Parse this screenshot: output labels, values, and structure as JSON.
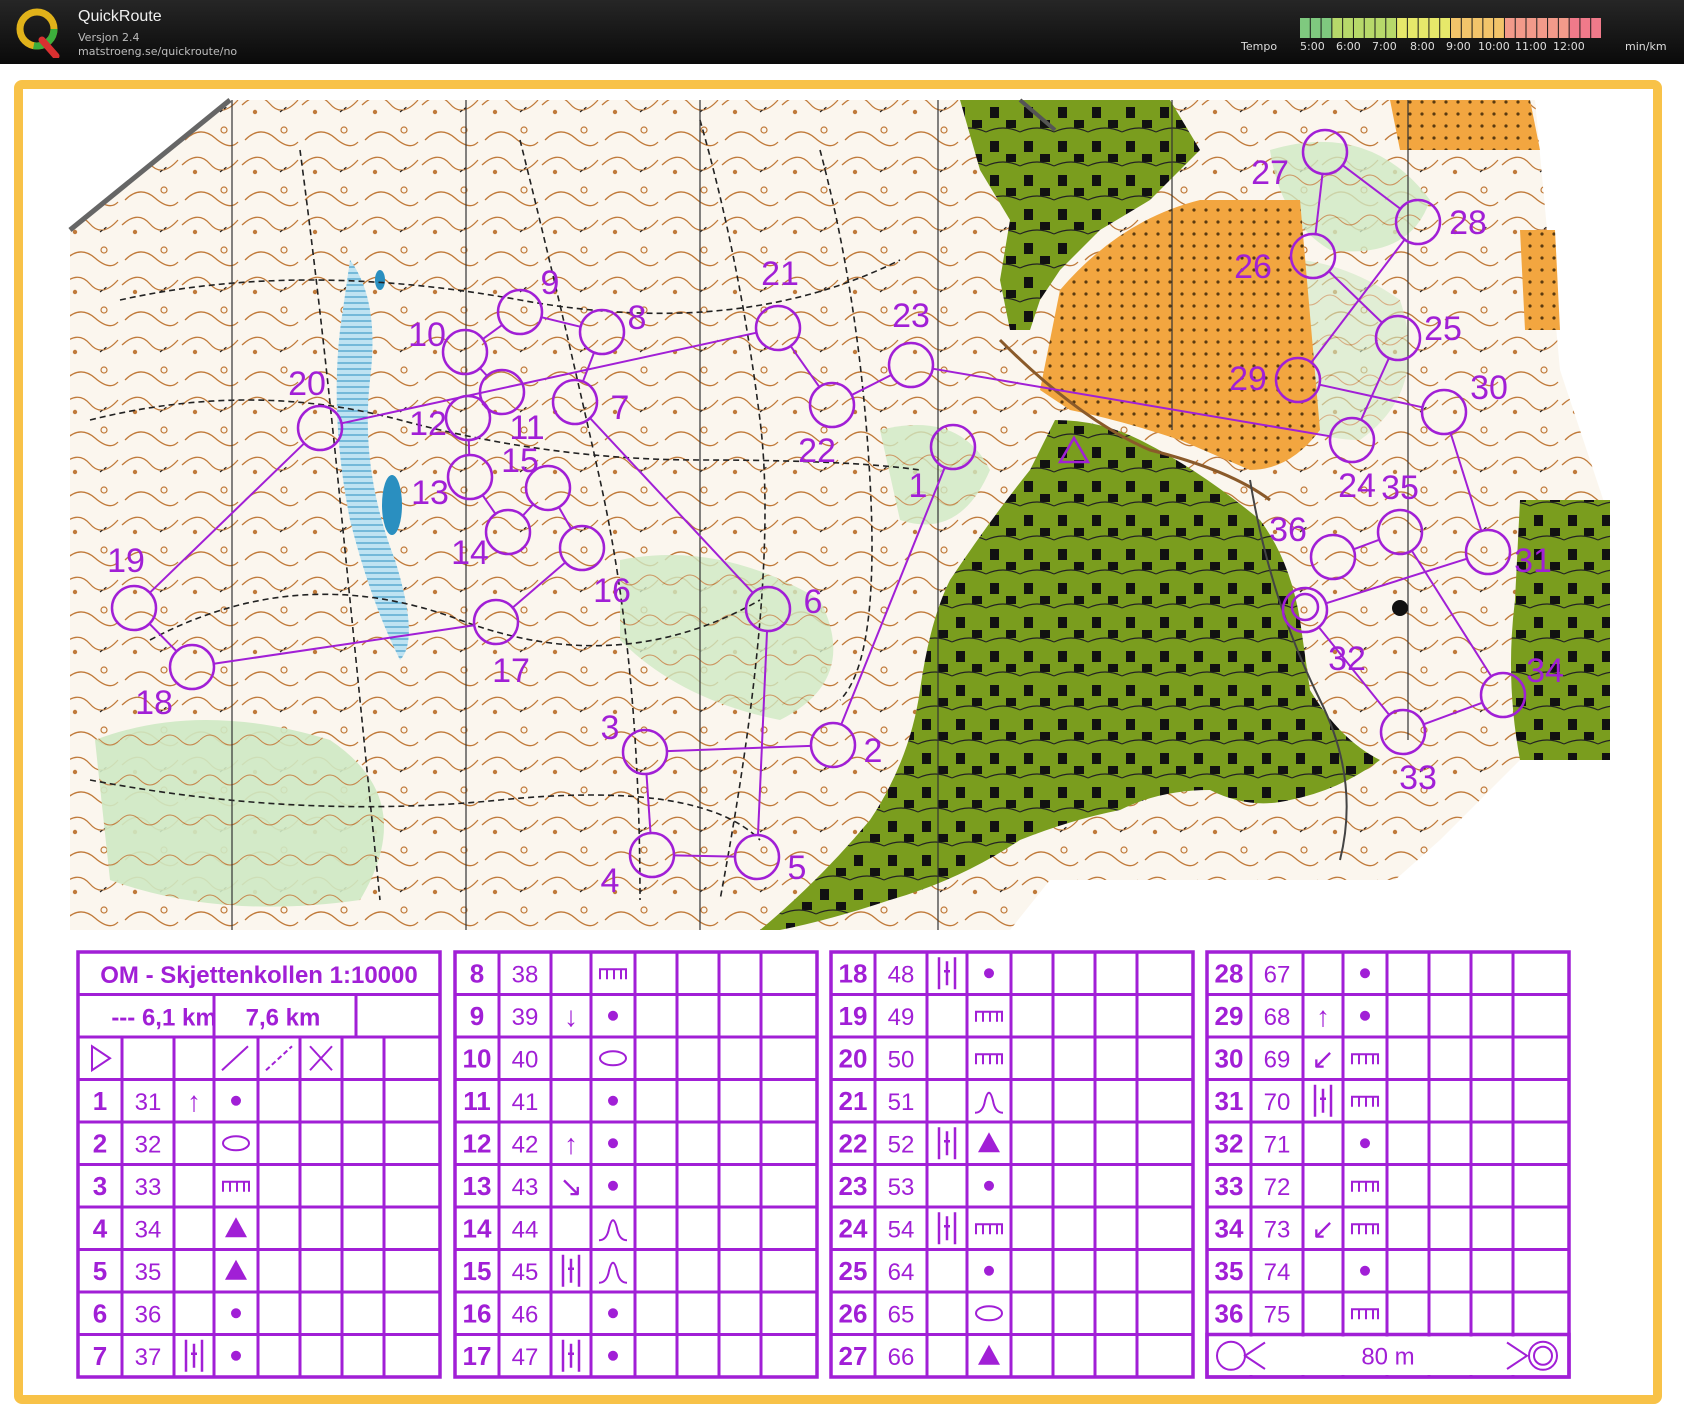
{
  "app": {
    "name": "QuickRoute",
    "version": "Versjon 2.4",
    "url": "matstroeng.se/quickroute/no"
  },
  "tempo": {
    "label": "Tempo",
    "ticks": [
      "5:00",
      "6:00",
      "7:00",
      "8:00",
      "9:00",
      "10:00",
      "11:00",
      "12:00"
    ],
    "unit": "min/km",
    "colors": [
      "#7fc97f",
      "#b7d96a",
      "#e6e86a",
      "#f2c46a",
      "#f29a8a",
      "#f07a8a"
    ]
  },
  "colors": {
    "course": "#a11fd6",
    "frame": "#f8c248",
    "green_area": "#7a9d1e",
    "orange_area": "#f2a640"
  },
  "map": {
    "controls": [
      {
        "n": "1"
      },
      {
        "n": "2"
      },
      {
        "n": "3"
      },
      {
        "n": "4"
      },
      {
        "n": "5"
      },
      {
        "n": "6"
      },
      {
        "n": "7"
      },
      {
        "n": "8"
      },
      {
        "n": "9"
      },
      {
        "n": "10"
      },
      {
        "n": "11"
      },
      {
        "n": "12"
      },
      {
        "n": "13"
      },
      {
        "n": "14"
      },
      {
        "n": "15"
      },
      {
        "n": "16"
      },
      {
        "n": "17"
      },
      {
        "n": "18"
      },
      {
        "n": "19"
      },
      {
        "n": "20"
      },
      {
        "n": "21"
      },
      {
        "n": "22"
      },
      {
        "n": "23"
      },
      {
        "n": "24"
      },
      {
        "n": "25"
      },
      {
        "n": "26"
      },
      {
        "n": "27"
      },
      {
        "n": "28"
      },
      {
        "n": "29"
      },
      {
        "n": "30"
      },
      {
        "n": "31"
      },
      {
        "n": "32"
      },
      {
        "n": "33"
      },
      {
        "n": "34"
      },
      {
        "n": "35"
      },
      {
        "n": "36"
      }
    ]
  },
  "description": {
    "title": "OM - Skjettenkollen 1:10000",
    "dist1": "--- 6,1 km",
    "dist2": "7,6 km",
    "finish_text": "80 m",
    "col1": [
      {
        "n": "1",
        "code": "31",
        "dir": "↑",
        "sym": "dot"
      },
      {
        "n": "2",
        "code": "32",
        "dir": "",
        "sym": "ellipse"
      },
      {
        "n": "3",
        "code": "33",
        "dir": "",
        "sym": "comb"
      },
      {
        "n": "4",
        "code": "34",
        "dir": "",
        "sym": "triangle"
      },
      {
        "n": "5",
        "code": "35",
        "dir": "",
        "sym": "triangle"
      },
      {
        "n": "6",
        "code": "36",
        "dir": "",
        "sym": "dot"
      },
      {
        "n": "7",
        "code": "37",
        "dir": "|||",
        "sym": "dot"
      }
    ],
    "col2": [
      {
        "n": "8",
        "code": "38",
        "dir": "",
        "sym": "comb"
      },
      {
        "n": "9",
        "code": "39",
        "dir": "↓",
        "sym": "dot"
      },
      {
        "n": "10",
        "code": "40",
        "dir": "",
        "sym": "ellipse"
      },
      {
        "n": "11",
        "code": "41",
        "dir": "",
        "sym": "dot"
      },
      {
        "n": "12",
        "code": "42",
        "dir": "↑",
        "sym": "dot"
      },
      {
        "n": "13",
        "code": "43",
        "dir": "↘",
        "sym": "dot"
      },
      {
        "n": "14",
        "code": "44",
        "dir": "",
        "sym": "hill"
      },
      {
        "n": "15",
        "code": "45",
        "dir": "|||",
        "sym": "hill"
      },
      {
        "n": "16",
        "code": "46",
        "dir": "",
        "sym": "dot"
      },
      {
        "n": "17",
        "code": "47",
        "dir": "|||",
        "sym": "dot"
      }
    ],
    "col3": [
      {
        "n": "18",
        "code": "48",
        "dir": "|||",
        "sym": "dot"
      },
      {
        "n": "19",
        "code": "49",
        "dir": "",
        "sym": "comb"
      },
      {
        "n": "20",
        "code": "50",
        "dir": "",
        "sym": "comb"
      },
      {
        "n": "21",
        "code": "51",
        "dir": "",
        "sym": "hill"
      },
      {
        "n": "22",
        "code": "52",
        "dir": "|||",
        "sym": "triangle"
      },
      {
        "n": "23",
        "code": "53",
        "dir": "",
        "sym": "dot"
      },
      {
        "n": "24",
        "code": "54",
        "dir": "|||",
        "sym": "comb"
      },
      {
        "n": "25",
        "code": "64",
        "dir": "",
        "sym": "dot"
      },
      {
        "n": "26",
        "code": "65",
        "dir": "",
        "sym": "ellipse"
      },
      {
        "n": "27",
        "code": "66",
        "dir": "",
        "sym": "triangle"
      }
    ],
    "col4": [
      {
        "n": "28",
        "code": "67",
        "dir": "",
        "sym": "dot"
      },
      {
        "n": "29",
        "code": "68",
        "dir": "↑",
        "sym": "dot"
      },
      {
        "n": "30",
        "code": "69",
        "dir": "↙",
        "sym": "comb"
      },
      {
        "n": "31",
        "code": "70",
        "dir": "|||",
        "sym": "comb"
      },
      {
        "n": "32",
        "code": "71",
        "dir": "",
        "sym": "dot"
      },
      {
        "n": "33",
        "code": "72",
        "dir": "",
        "sym": "comb"
      },
      {
        "n": "34",
        "code": "73",
        "dir": "↙",
        "sym": "comb"
      },
      {
        "n": "35",
        "code": "74",
        "dir": "",
        "sym": "dot"
      },
      {
        "n": "36",
        "code": "75",
        "dir": "",
        "sym": "comb"
      }
    ]
  }
}
